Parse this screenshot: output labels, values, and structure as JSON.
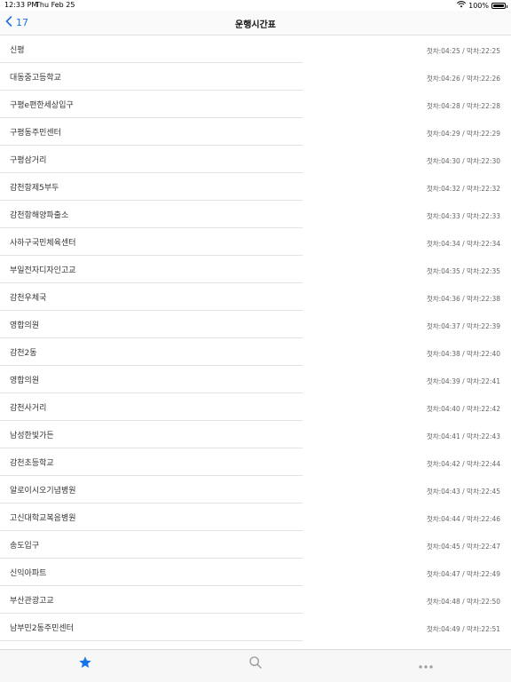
{
  "status_bar": {
    "time": "12:33 PM",
    "date": "Thu Feb 25",
    "battery": "100%"
  },
  "nav": {
    "back_label": "17",
    "title": "운행시간표"
  },
  "stops": [
    {
      "name": "신평",
      "times": "첫차:04:25 / 막차:22:25"
    },
    {
      "name": "대동중고등학교",
      "times": "첫차:04:26 / 막차:22:26"
    },
    {
      "name": "구평e편한세상입구",
      "times": "첫차:04:28 / 막차:22:28"
    },
    {
      "name": "구평동주민센터",
      "times": "첫차:04:29 / 막차:22:29"
    },
    {
      "name": "구평삼거리",
      "times": "첫차:04:30 / 막차:22:30"
    },
    {
      "name": "감천항제5부두",
      "times": "첫차:04:32 / 막차:22:32"
    },
    {
      "name": "감천항해양파출소",
      "times": "첫차:04:33 / 막차:22:33"
    },
    {
      "name": "사하구국민체육센터",
      "times": "첫차:04:34 / 막차:22:34"
    },
    {
      "name": "부일전자디자인고교",
      "times": "첫차:04:35 / 막차:22:35"
    },
    {
      "name": "감천우체국",
      "times": "첫차:04:36 / 막차:22:38"
    },
    {
      "name": "영합의원",
      "times": "첫차:04:37 / 막차:22:39"
    },
    {
      "name": "감천2동",
      "times": "첫차:04:38 / 막차:22:40"
    },
    {
      "name": "영합의원",
      "times": "첫차:04:39 / 막차:22:41"
    },
    {
      "name": "감천사거리",
      "times": "첫차:04:40 / 막차:22:42"
    },
    {
      "name": "남성한빛가든",
      "times": "첫차:04:41 / 막차:22:43"
    },
    {
      "name": "감천초등학교",
      "times": "첫차:04:42 / 막차:22:44"
    },
    {
      "name": "알로이시오기념병원",
      "times": "첫차:04:43 / 막차:22:45"
    },
    {
      "name": "고신대학교복음병원",
      "times": "첫차:04:44 / 막차:22:46"
    },
    {
      "name": "송도입구",
      "times": "첫차:04:45 / 막차:22:47"
    },
    {
      "name": "신익아파트",
      "times": "첫차:04:47 / 막차:22:49"
    },
    {
      "name": "부산관광고교",
      "times": "첫차:04:48 / 막차:22:50"
    },
    {
      "name": "남부민2동주민센터",
      "times": "첫차:04:49 / 막차:22:51"
    }
  ],
  "tab_bar": {
    "items": [
      {
        "icon": "star-icon",
        "color": "#1a73e8"
      },
      {
        "icon": "search-icon",
        "color": "#9a9a9a"
      },
      {
        "icon": "more-icon",
        "color": "#9a9a9a"
      }
    ]
  },
  "colors": {
    "accent": "#1a73e8",
    "separator": "#e3e3e3"
  }
}
